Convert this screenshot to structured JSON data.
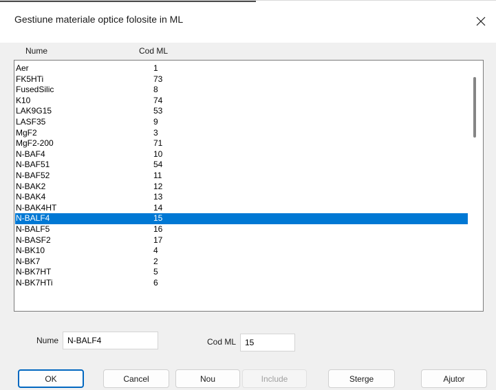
{
  "window": {
    "title": "Gestiune materiale optice folosite in ML"
  },
  "list": {
    "columns": {
      "name": "Nume",
      "code": "Cod ML"
    },
    "selected_index": 14,
    "rows": [
      {
        "name": "Aer",
        "code": "1"
      },
      {
        "name": "FK5HTi",
        "code": "73"
      },
      {
        "name": "FusedSilic",
        "code": "8"
      },
      {
        "name": "K10",
        "code": "74"
      },
      {
        "name": "LAK9G15",
        "code": "53"
      },
      {
        "name": "LASF35",
        "code": "9"
      },
      {
        "name": "MgF2",
        "code": "3"
      },
      {
        "name": "MgF2-200",
        "code": "71"
      },
      {
        "name": "N-BAF4",
        "code": "10"
      },
      {
        "name": "N-BAF51",
        "code": "54"
      },
      {
        "name": "N-BAF52",
        "code": "11"
      },
      {
        "name": "N-BAK2",
        "code": "12"
      },
      {
        "name": "N-BAK4",
        "code": "13"
      },
      {
        "name": "N-BAK4HT",
        "code": "14"
      },
      {
        "name": "N-BALF4",
        "code": "15"
      },
      {
        "name": "N-BALF5",
        "code": "16"
      },
      {
        "name": "N-BASF2",
        "code": "17"
      },
      {
        "name": "N-BK10",
        "code": "4"
      },
      {
        "name": "N-BK7",
        "code": "2"
      },
      {
        "name": "N-BK7HT",
        "code": "5"
      },
      {
        "name": "N-BK7HTi",
        "code": "6"
      }
    ]
  },
  "form": {
    "name_label": "Nume",
    "name_value": "N-BALF4",
    "code_label": "Cod ML",
    "code_value": "15"
  },
  "buttons": {
    "ok": "OK",
    "cancel": "Cancel",
    "new": "Nou",
    "include": "Include",
    "delete": "Sterge",
    "help": "Ajutor"
  },
  "colors": {
    "selection": "#0078d4",
    "default_button_border": "#0067c0"
  },
  "icons": {
    "close": "close-icon"
  }
}
